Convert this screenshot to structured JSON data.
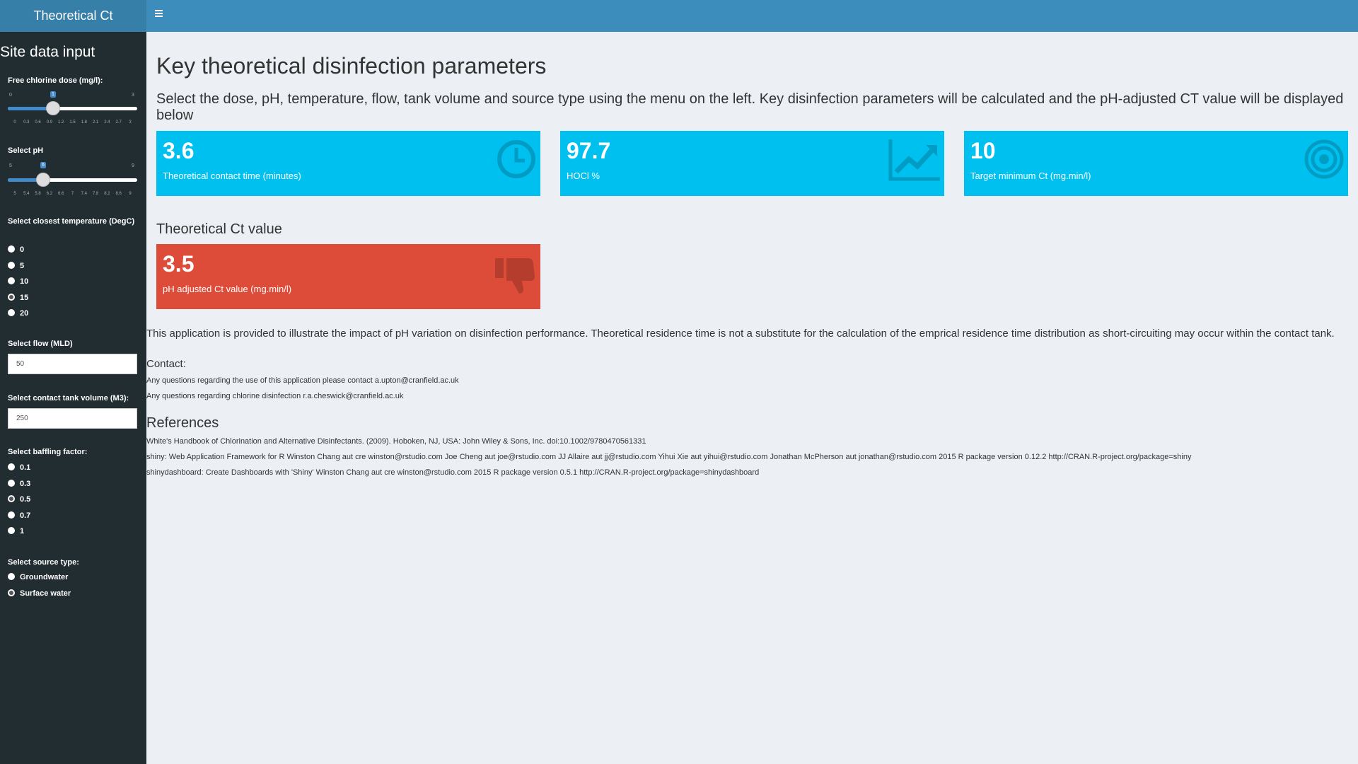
{
  "header": {
    "title": "Theoretical Ct"
  },
  "sidebar": {
    "title": "Site data input",
    "dose": {
      "label": "Free chlorine dose (mg/l):",
      "min": "0",
      "max": "3",
      "value": "1",
      "ticks": [
        "0",
        "0.3",
        "0.6",
        "0.9",
        "1.2",
        "1.5",
        "1.8",
        "2.1",
        "2.4",
        "2.7",
        "3"
      ]
    },
    "ph": {
      "label": "Select pH",
      "min": "5",
      "max": "9",
      "value": "6",
      "ticks": [
        "5",
        "5.4",
        "5.8",
        "6.2",
        "6.6",
        "7",
        "7.4",
        "7.8",
        "8.2",
        "8.6",
        "9"
      ]
    },
    "temperature": {
      "label": "Select closest temperature (DegC)",
      "options": [
        "0",
        "5",
        "10",
        "15",
        "20"
      ],
      "selected": "15"
    },
    "flow": {
      "label": "Select flow (MLD)",
      "value": "50"
    },
    "volume": {
      "label": "Select contact tank volume (M3):",
      "value": "250"
    },
    "baffling": {
      "label": "Select baffling factor:",
      "options": [
        "0.1",
        "0.3",
        "0.5",
        "0.7",
        "1"
      ],
      "selected": "0.5"
    },
    "source": {
      "label": "Select source type:",
      "options": [
        "Groundwater",
        "Surface water"
      ],
      "selected": "Surface water"
    }
  },
  "main": {
    "title": "Key theoretical disinfection parameters",
    "intro": "Select the dose, pH, temperature, flow, tank volume and source type using the menu on the left. Key disinfection parameters will be calculated and the pH-adjusted CT value will be displayed below",
    "boxes": [
      {
        "value": "3.6",
        "subtitle": "Theoretical contact time (minutes)",
        "icon": "clock-icon",
        "color": "#00c0ef"
      },
      {
        "value": "97.7",
        "subtitle": "HOCl %",
        "icon": "line-chart-icon",
        "color": "#00c0ef"
      },
      {
        "value": "10",
        "subtitle": "Target minimum Ct (mg.min/l)",
        "icon": "bullseye-icon",
        "color": "#00c0ef"
      }
    ],
    "ct_heading": "Theoretical Ct value",
    "ct_box": {
      "value": "3.5",
      "subtitle": "pH adjusted Ct value (mg.min/l)",
      "icon": "thumbs-down-icon",
      "color": "#dd4b39"
    },
    "note": "This application is provided to illustrate the impact of pH variation on disinfection performance. Theoretical residence time is not a substitute for the calculation of the emprical residence time distribution as short-circuiting may occur within the contact tank.",
    "contact_heading": "Contact:",
    "contact_lines": [
      "Any questions regarding the use of this application please contact a.upton@cranfield.ac.uk",
      "Any questions regarding chlorine disinfection r.a.cheswick@cranfield.ac.uk"
    ],
    "references_heading": "References",
    "references": [
      "White's Handbook of Chlorination and Alternative Disinfectants. (2009). Hoboken, NJ, USA: John Wiley & Sons, Inc. doi:10.1002/9780470561331",
      "shiny: Web Application Framework for R Winston Chang aut cre winston@rstudio.com Joe Cheng aut joe@rstudio.com JJ Allaire aut jj@rstudio.com Yihui Xie aut yihui@rstudio.com Jonathan McPherson aut jonathan@rstudio.com 2015 R package version 0.12.2 http://CRAN.R-project.org/package=shiny",
      "shinydashboard: Create Dashboards with 'Shiny' Winston Chang aut cre winston@rstudio.com 2015 R package version 0.5.1 http://CRAN.R-project.org/package=shinydashboard"
    ]
  }
}
